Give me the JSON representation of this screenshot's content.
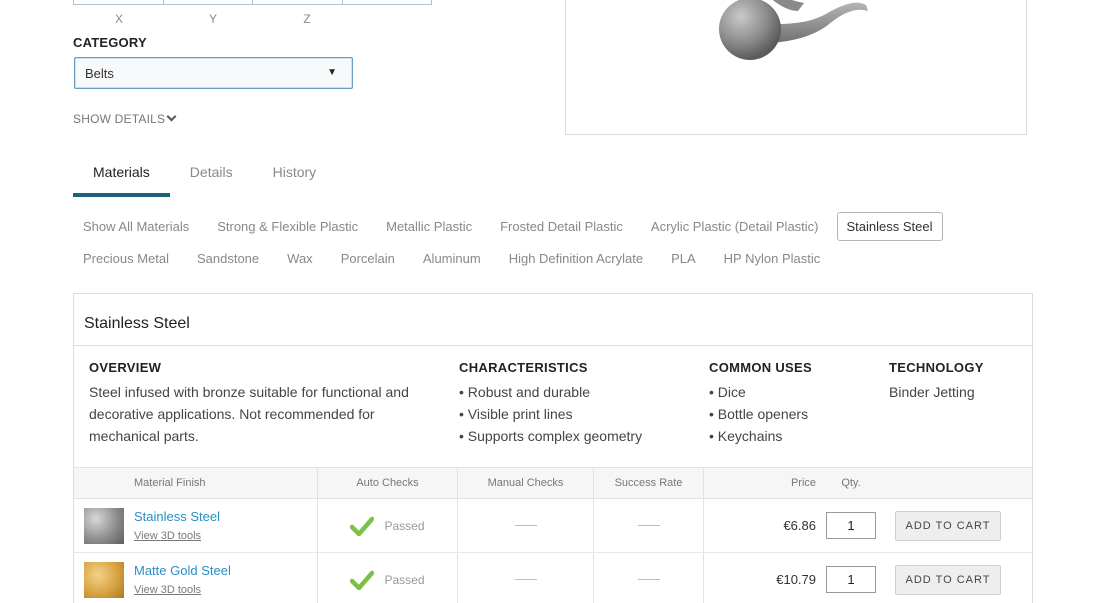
{
  "dimensions": {
    "axes": [
      "X",
      "Y",
      "Z"
    ]
  },
  "category": {
    "label": "CATEGORY",
    "selected": "Belts"
  },
  "show_details": "SHOW DETAILS",
  "tabs": [
    {
      "label": "Materials",
      "active": true
    },
    {
      "label": "Details",
      "active": false
    },
    {
      "label": "History",
      "active": false
    }
  ],
  "material_chips": {
    "row1": [
      "Show All Materials",
      "Strong & Flexible Plastic",
      "Metallic Plastic",
      "Frosted Detail Plastic",
      "Acrylic Plastic (Detail Plastic)",
      "Stainless Steel"
    ],
    "row2": [
      "Precious Metal",
      "Sandstone",
      "Wax",
      "Porcelain",
      "Aluminum",
      "High Definition Acrylate",
      "PLA",
      "HP Nylon Plastic"
    ],
    "selected": "Stainless Steel"
  },
  "panel": {
    "title": "Stainless Steel",
    "overview": {
      "heading": "OVERVIEW",
      "text": "Steel infused with bronze suitable for functional and decorative applications. Not recommended for mechanical parts."
    },
    "characteristics": {
      "heading": "CHARACTERISTICS",
      "items": [
        "• Robust and durable",
        "• Visible print lines",
        "• Supports complex geometry"
      ]
    },
    "common_uses": {
      "heading": "COMMON USES",
      "items": [
        "• Dice",
        "• Bottle openers",
        "• Keychains"
      ]
    },
    "technology": {
      "heading": "TECHNOLOGY",
      "text": "Binder Jetting"
    }
  },
  "table": {
    "headers": [
      "Material Finish",
      "Auto Checks",
      "Manual Checks",
      "Success Rate",
      "Price",
      "Qty."
    ],
    "rows": [
      {
        "name": "Stainless Steel",
        "tools": "View 3D tools",
        "auto": "Passed",
        "price": "€6.86",
        "qty": "1",
        "cart": "ADD TO CART",
        "swatch": "steel"
      },
      {
        "name": "Matte Gold Steel",
        "tools": "View 3D tools",
        "auto": "Passed",
        "price": "€10.79",
        "qty": "1",
        "cart": "ADD TO CART",
        "swatch": "gold"
      }
    ]
  },
  "colors": {
    "accent_tab": "#1d5f80",
    "link": "#2a8fc4",
    "check": "#7cc04a"
  }
}
